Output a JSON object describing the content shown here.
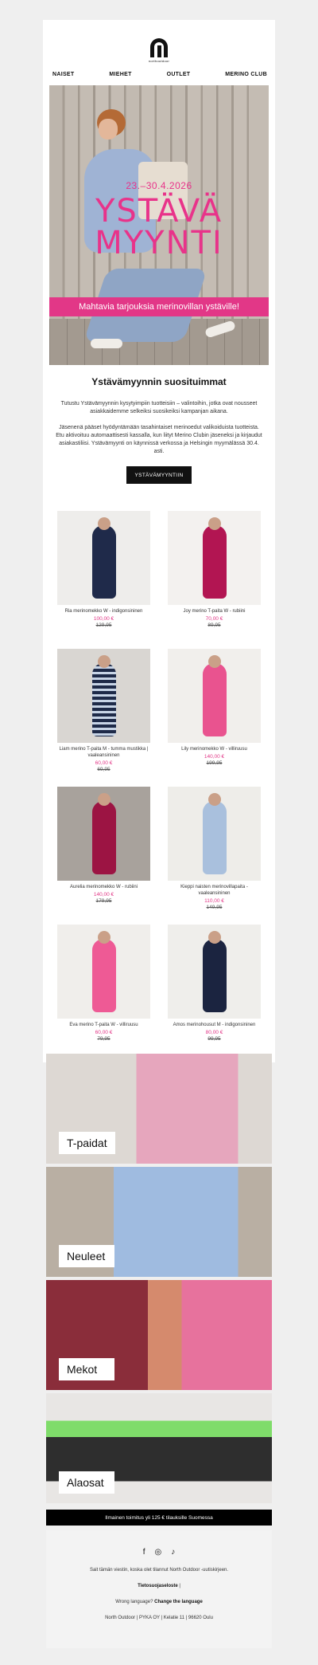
{
  "brand": {
    "logo_text": "northoutdoor"
  },
  "nav": [
    "NAISET",
    "MIEHET",
    "OUTLET",
    "MERINO CLUB"
  ],
  "hero": {
    "dates": "23.–30.4.2026",
    "title_line1": "YSTÄVÄ",
    "title_line2": "MYYNTI",
    "strip": "Mahtavia tarjouksia merinovillan ystäville!"
  },
  "intro": {
    "title": "Ystävämyynnin suosituimmat",
    "p1": "Tutustu Ystävämyynnin kysytyimpiin tuotteisiin – valintoihin, jotka ovat nousseet asiakkaidemme selkeiksi suosikeiksi kampanjan aikana.",
    "p2": "Jäsenenä pääset hyödyntämään tasahintaiset merinoedut valikoiduista tuotteista. Etu aktivoituu automaattisesti kassalla, kun liityt Merino Clubin jäseneksi ja kirjaudut asiakastiliisi. Ystävämyynti on käynnissä verkossa ja Helsingin myymälässä 30.4. asti.",
    "cta": "YSTÄVÄMYYNTIIN"
  },
  "products": [
    {
      "name": "Ria merinomekko W - indigonsininen",
      "price": "100,00 €",
      "old": "129,95"
    },
    {
      "name": "Joy merino T-paita W - rubiini",
      "price": "70,00 €",
      "old": "89,95"
    },
    {
      "name": "Liam merino T-paita M - tumma mustikka | vaaleansininen",
      "price": "60,00 €",
      "old": "69,95"
    },
    {
      "name": "Lily merinomekko W - villiruusu",
      "price": "140,00 €",
      "old": "199,95"
    },
    {
      "name": "Aurelia merinomekko W - rubiini",
      "price": "140,00 €",
      "old": "179,95"
    },
    {
      "name": "Kieppi naisten merinovillapaita - vaaleansininen",
      "price": "110,00 €",
      "old": "149,95"
    },
    {
      "name": "Eva merino T-paita W - villiruusu",
      "price": "60,00 €",
      "old": "79,95"
    },
    {
      "name": "Amos merinohousut M - indigonsininen",
      "price": "80,00 €",
      "old": "99,95"
    }
  ],
  "categories": [
    "T-paidat",
    "Neuleet",
    "Mekot",
    "Alaosat"
  ],
  "shipping": "Ilmainen toimitus yli 125 € tilauksille Suomessa",
  "footer": {
    "social_icons": [
      "facebook-icon",
      "instagram-icon",
      "tiktok-icon"
    ],
    "reason": "Sait tämän viestin, koska olet tilannut North Outdoor -uutiskirjeen.",
    "privacy": "Tietosuojaseloste",
    "privacy_sep": "|",
    "wrong_lang": "Wrong language?",
    "change_lang": "Change the language",
    "address": "North Outdoor | PYKA OY | Kelatie 11 | 96620 Oulu"
  },
  "colors": {
    "accent": "#e23787",
    "black": "#111111"
  }
}
